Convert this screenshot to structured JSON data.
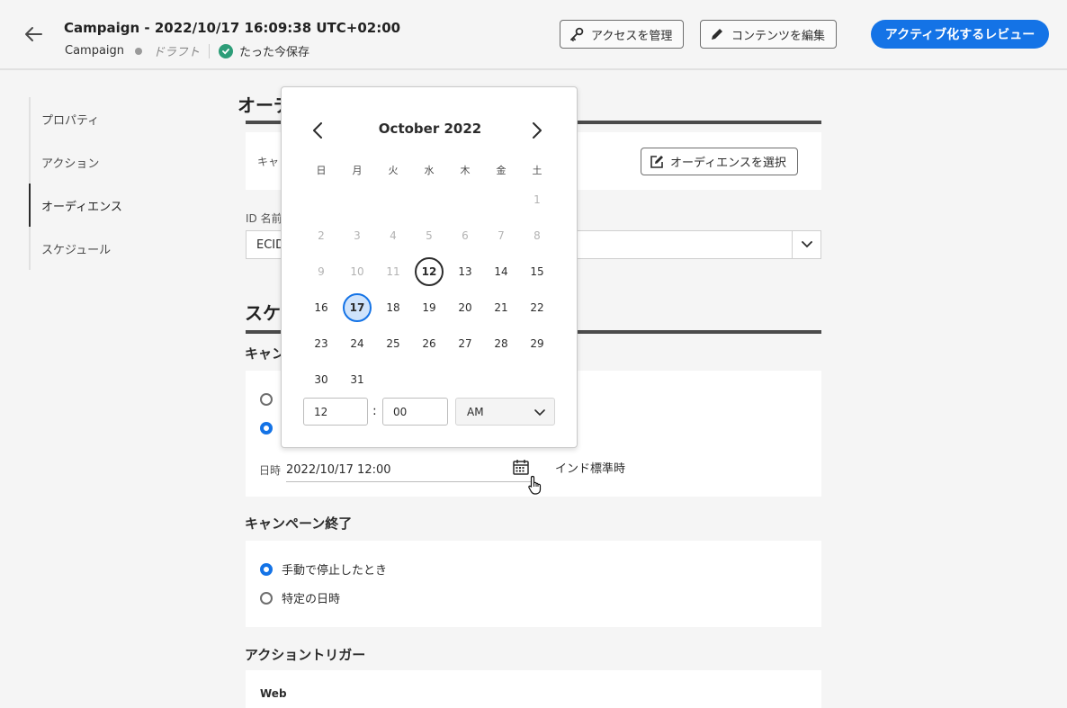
{
  "header": {
    "title": "Campaign - 2022/10/17  16:09:38 UTC+02:00",
    "breadcrumb": "Campaign",
    "status": "ドラフト",
    "saved": "たった今保存",
    "manage_access": "アクセスを管理",
    "edit_content": "コンテンツを編集",
    "activate_review": "アクティブ化するレビュー"
  },
  "leftnav": {
    "items": [
      {
        "label": "プロパティ"
      },
      {
        "label": "アクション"
      },
      {
        "label": "オーディエンス"
      },
      {
        "label": "スケジュール"
      }
    ]
  },
  "audience": {
    "heading": "オーデ",
    "card_label": "キャ",
    "select_button": "オーディエンスを選択",
    "id_label": "ID 名前",
    "id_value": "ECID"
  },
  "schedule": {
    "heading": "スケ",
    "start_heading": "キャン",
    "date_label": "日時",
    "date_value": "2022/10/17 12:00",
    "timezone": "インド標準時",
    "end_heading": "キャンペーン終了",
    "end_opt_manual": "手動で停止したとき",
    "end_opt_specific": "特定の日時",
    "action_trigger_heading": "アクショントリガー",
    "web_label": "Web"
  },
  "calendar": {
    "month_title": "October 2022",
    "weekdays": [
      "日",
      "月",
      "火",
      "水",
      "木",
      "金",
      "土"
    ],
    "first_weekday_index": 6,
    "days_in_month": 31,
    "today": 12,
    "selected": 17,
    "first_enabled_day": 12,
    "hour": "12",
    "minute": "00",
    "ampm": "AM"
  },
  "colors": {
    "accent": "#1473e6",
    "success": "#2d9d78"
  }
}
